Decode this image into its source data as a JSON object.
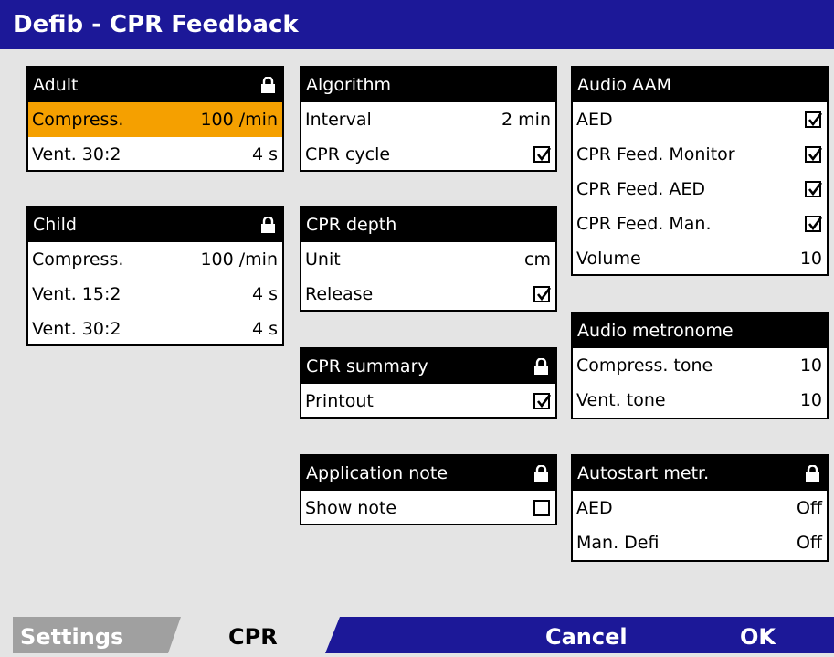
{
  "title": "Defib - CPR Feedback",
  "panels": {
    "adult": {
      "header": "Adult",
      "locked": true,
      "rows": [
        {
          "label": "Compress.",
          "value": "100 /min",
          "selected": true
        },
        {
          "label": "Vent. 30:2",
          "value": "4 s"
        }
      ]
    },
    "child": {
      "header": "Child",
      "locked": true,
      "rows": [
        {
          "label": "Compress.",
          "value": "100 /min"
        },
        {
          "label": "Vent. 15:2",
          "value": "4 s"
        },
        {
          "label": "Vent. 30:2",
          "value": "4 s"
        }
      ]
    },
    "algorithm": {
      "header": "Algorithm",
      "rows": [
        {
          "label": "Interval",
          "value": "2 min"
        },
        {
          "label": "CPR cycle",
          "checked": true
        }
      ]
    },
    "cpr_depth": {
      "header": "CPR depth",
      "rows": [
        {
          "label": "Unit",
          "value": "cm"
        },
        {
          "label": "Release",
          "checked": true
        }
      ]
    },
    "cpr_summary": {
      "header": "CPR summary",
      "locked": true,
      "rows": [
        {
          "label": "Printout",
          "checked": true
        }
      ]
    },
    "application_note": {
      "header": "Application note",
      "locked": true,
      "rows": [
        {
          "label": "Show note",
          "checked": false
        }
      ]
    },
    "audio_aam": {
      "header": "Audio AAM",
      "rows": [
        {
          "label": "AED",
          "checked": true
        },
        {
          "label": "CPR Feed. Monitor",
          "checked": true
        },
        {
          "label": "CPR Feed. AED",
          "checked": true
        },
        {
          "label": "CPR Feed. Man.",
          "checked": true
        },
        {
          "label": "Volume",
          "value": "10"
        }
      ]
    },
    "audio_metronome": {
      "header": "Audio metronome",
      "rows": [
        {
          "label": "Compress. tone",
          "value": "10"
        },
        {
          "label": "Vent. tone",
          "value": "10"
        }
      ]
    },
    "autostart_metr": {
      "header": "Autostart metr.",
      "locked": true,
      "rows": [
        {
          "label": "AED",
          "value": "Off"
        },
        {
          "label": "Man. Defi",
          "value": "Off"
        }
      ]
    }
  },
  "bottom_tabs": {
    "settings": "Settings",
    "cpr": "CPR",
    "cancel": "Cancel",
    "ok": "OK"
  },
  "colors": {
    "title_bar": "#1c1898",
    "selected_row": "#f5a000",
    "background": "#e4e4e4",
    "inactive_tab": "#a0a0a0"
  }
}
